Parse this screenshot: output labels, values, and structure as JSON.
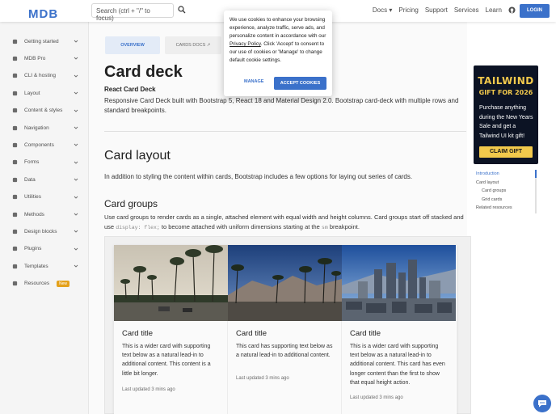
{
  "navbar": {
    "logo": "MDB",
    "search_placeholder": "Search (ctrl + \"/\" to focus)",
    "links": [
      "Docs ▾",
      "Pricing",
      "Support",
      "Services",
      "Learn"
    ],
    "login_label": "LOGIN"
  },
  "sidebar": {
    "items": [
      {
        "label": "Getting started",
        "icon": "rocket-icon"
      },
      {
        "label": "MDB Pro",
        "icon": "gem-icon"
      },
      {
        "label": "CLI & hosting",
        "icon": "cloud-icon"
      },
      {
        "label": "Layout",
        "icon": "layout-icon"
      },
      {
        "label": "Content & styles",
        "icon": "pen-icon"
      },
      {
        "label": "Navigation",
        "icon": "compass-icon"
      },
      {
        "label": "Components",
        "icon": "cubes-icon"
      },
      {
        "label": "Forms",
        "icon": "form-icon"
      },
      {
        "label": "Data",
        "icon": "table-icon"
      },
      {
        "label": "Utilities",
        "icon": "wrench-icon"
      },
      {
        "label": "Methods",
        "icon": "code-icon"
      },
      {
        "label": "Design blocks",
        "icon": "blocks-icon"
      },
      {
        "label": "Plugins",
        "icon": "plug-icon"
      },
      {
        "label": "Templates",
        "icon": "file-icon"
      },
      {
        "label": "Resources",
        "icon": "tools-icon",
        "badge": "New"
      }
    ]
  },
  "tabs": {
    "overview": "OVERVIEW",
    "api": "CARDS DOCS"
  },
  "page": {
    "title": "Card deck",
    "subtitle": "React Card Deck",
    "description": "Responsive Card Deck built with Bootstrap 5, React 18 and Material Design 2.0. Bootstrap card-deck with multiple rows and standard breakpoints.",
    "section_title": "Card layout",
    "section_text": "In addition to styling the content within cards, Bootstrap includes a few options for laying out series of cards.",
    "groups_title": "Card groups",
    "groups_text_1": "Use card groups to render cards as a single, attached element with equal width and height columns. Card groups start off stacked and use",
    "groups_code_1": "display: flex;",
    "groups_text_2": "to become attached with uniform dimensions starting at the",
    "groups_code_2": "sm",
    "groups_text_3": "breakpoint."
  },
  "cards": [
    {
      "title": "Card title",
      "text": "This is a wider card with supporting text below as a natural lead-in to additional content. This content is a little bit longer.",
      "footer": "Last updated 3 mins ago"
    },
    {
      "title": "Card title",
      "text": "This card has supporting text below as a natural lead-in to additional content.",
      "footer": "Last updated 3 mins ago"
    },
    {
      "title": "Card title",
      "text": "This is a wider card with supporting text below as a natural lead-in to additional content. This card has even longer content than the first to show that equal height action.",
      "footer": "Last updated 3 mins ago"
    }
  ],
  "ad": {
    "title": "TAILWIND",
    "subtitle": "GIFT FOR 2026",
    "text": "Purchase anything during the New Years Sale and get a Tailwind UI kit gift!",
    "button": "CLAIM GIFT"
  },
  "toc": {
    "items": [
      "Introduction",
      "Card layout",
      "Card groups",
      "Grid cards",
      "Related resources"
    ]
  },
  "cookie": {
    "text_1": "We use cookies to enhance your browsing experience, analyze traffic, serve ads, and personalize content in accordance with our",
    "link": "Privacy Policy",
    "text_2": ". Click 'Accept' to consent to our use of cookies or 'Manage' to change default cookie settings.",
    "manage": "MANAGE",
    "accept": "ACCEPT COOKIES"
  },
  "colors": {
    "primary": "#3b71ca",
    "ad_bg": "#0c1324",
    "ad_accent": "#f2c94c"
  }
}
